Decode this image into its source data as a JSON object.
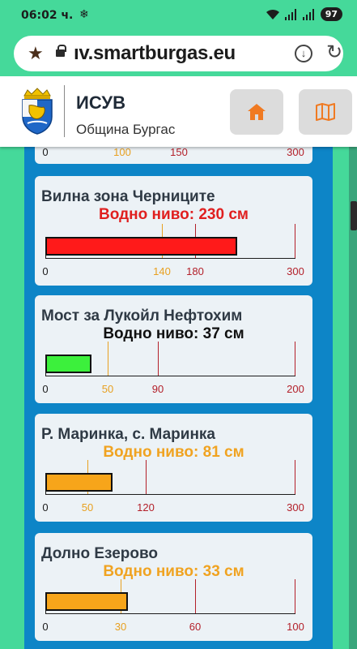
{
  "status_bar": {
    "time": "06:02 ч.",
    "extra_icon": "snowflake-icon",
    "battery": "97"
  },
  "browser": {
    "url": "ıv.smartburgas.eu"
  },
  "header": {
    "title": "ИСУВ",
    "subtitle": "Община Бургас"
  },
  "colors": {
    "red": "#ff1a1a",
    "green": "#3cf03c",
    "orange": "#f7a51a",
    "warn_yellow": "#f0a321",
    "alarm_red": "#c0262e"
  },
  "partial_card": {
    "ticks": [
      "0",
      "100",
      "150",
      "300"
    ]
  },
  "cards": [
    {
      "station": "Вилна зона Черниците",
      "level_text": "Водно ниво: 230 см",
      "level": 230,
      "max": 300,
      "fill_color": "#ff1a1a",
      "level_color": "#e01f1f",
      "ticks": [
        {
          "label": "0",
          "value": 0,
          "color": "#1c1c1c"
        },
        {
          "label": "140",
          "value": 140,
          "color": "#e8a020"
        },
        {
          "label": "180",
          "value": 180,
          "color": "#b3202a"
        },
        {
          "label": "300",
          "value": 300,
          "color": "#b3202a"
        }
      ]
    },
    {
      "station": "Мост за Лукойл Нефтохим",
      "level_text": "Водно ниво: 37 см",
      "level": 37,
      "max": 200,
      "fill_color": "#3cf03c",
      "level_color": "#111111",
      "ticks": [
        {
          "label": "0",
          "value": 0,
          "color": "#1c1c1c"
        },
        {
          "label": "50",
          "value": 50,
          "color": "#e8a020"
        },
        {
          "label": "90",
          "value": 90,
          "color": "#b3202a"
        },
        {
          "label": "200",
          "value": 200,
          "color": "#b3202a"
        }
      ]
    },
    {
      "station": "Р. Маринка, с. Маринка",
      "level_text": "Водно ниво: 81 см",
      "level": 81,
      "max": 300,
      "fill_color": "#f7a51a",
      "level_color": "#f0a321",
      "ticks": [
        {
          "label": "0",
          "value": 0,
          "color": "#1c1c1c"
        },
        {
          "label": "50",
          "value": 50,
          "color": "#e8a020"
        },
        {
          "label": "120",
          "value": 120,
          "color": "#b3202a"
        },
        {
          "label": "300",
          "value": 300,
          "color": "#b3202a"
        }
      ]
    },
    {
      "station": "Долно Езерово",
      "level_text": "Водно ниво: 33 см",
      "level": 33,
      "max": 100,
      "fill_color": "#f7a51a",
      "level_color": "#f0a321",
      "ticks": [
        {
          "label": "0",
          "value": 0,
          "color": "#1c1c1c"
        },
        {
          "label": "30",
          "value": 30,
          "color": "#e8a020"
        },
        {
          "label": "60",
          "value": 60,
          "color": "#b3202a"
        },
        {
          "label": "100",
          "value": 100,
          "color": "#b3202a"
        }
      ]
    }
  ]
}
